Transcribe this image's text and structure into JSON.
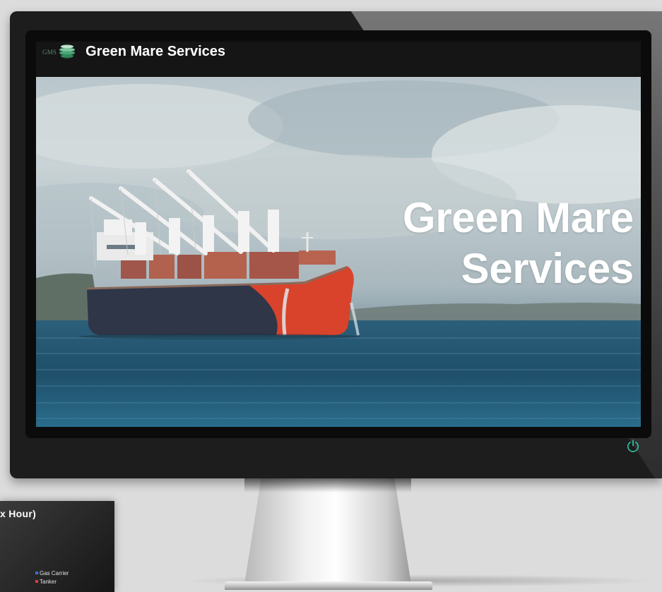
{
  "site": {
    "logo_text": "GMS",
    "brand": "Green Mare Services",
    "hero_title_line1": "Green Mare",
    "hero_title_line2": "Services"
  },
  "background_card": {
    "title_fragment": "x Hour)",
    "legend": [
      {
        "label": "Gas Carrier",
        "color": "#3b6fd8"
      },
      {
        "label": "Tanker",
        "color": "#e23b3b"
      }
    ]
  },
  "icons": {
    "logo": "globe-icon",
    "power": "power-icon"
  },
  "colors": {
    "accent": "#2fc8a8",
    "nav_background": "#151515",
    "ship_hull_bow": "#d9432b",
    "ship_hull": "#2e3648"
  }
}
